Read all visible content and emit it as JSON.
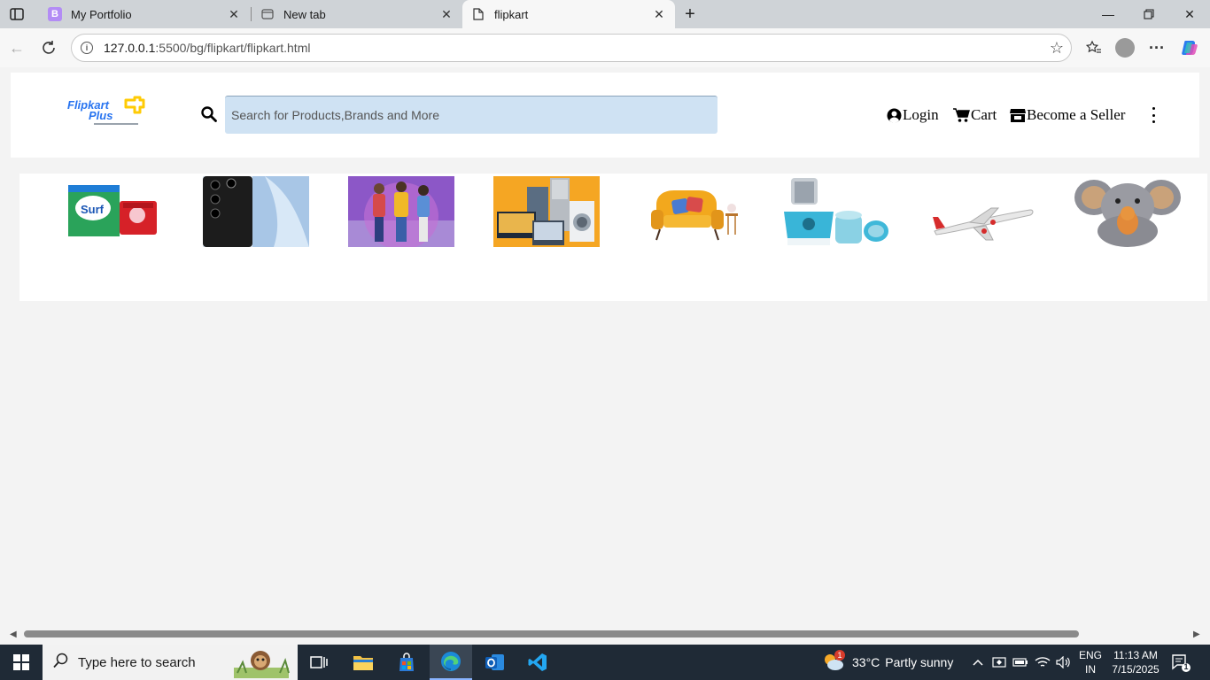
{
  "browser": {
    "tabs": [
      {
        "title": "My Portfolio",
        "favicon": "B"
      },
      {
        "title": "New tab"
      },
      {
        "title": "flipkart",
        "active": true
      }
    ],
    "address": {
      "host": "127.0.0.1",
      "path": ":5500/bg/flipkart/flipkart.html"
    }
  },
  "page": {
    "search": {
      "placeholder": "Search for Products,Brands and More"
    },
    "nav": {
      "login": "Login",
      "cart": "Cart",
      "seller": "Become a Seller"
    },
    "categories": [
      {
        "name": "grocery-image"
      },
      {
        "name": "mobiles-image"
      },
      {
        "name": "fashion-image"
      },
      {
        "name": "electronics-image"
      },
      {
        "name": "home-furniture-image"
      },
      {
        "name": "appliances-image"
      },
      {
        "name": "travel-image"
      },
      {
        "name": "toys-image"
      }
    ]
  },
  "taskbar": {
    "search_placeholder": "Type here to search",
    "weather": {
      "temp": "33°C",
      "condition": "Partly sunny",
      "badge": "1"
    },
    "lang": {
      "line1": "ENG",
      "line2": "IN"
    },
    "clock": {
      "time": "11:13 AM",
      "date": "7/15/2025"
    },
    "notifications": "1"
  },
  "colors": {
    "search_bg": "#cfe2f3",
    "taskbar_bg": "#1f2a36",
    "tabstrip_bg": "#cfd3d7"
  }
}
